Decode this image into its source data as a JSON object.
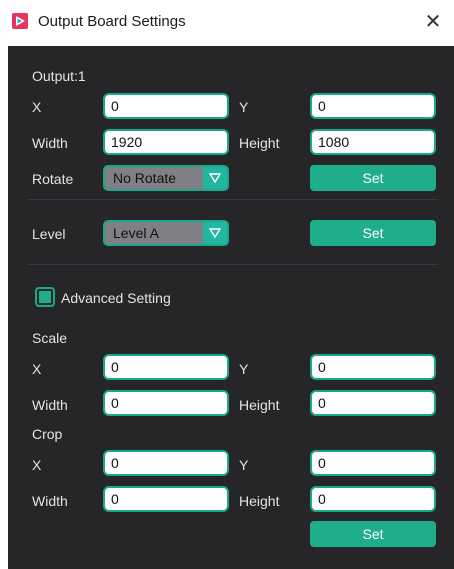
{
  "window": {
    "title": "Output Board Settings",
    "close_label": "✕"
  },
  "output": {
    "heading": "Output:1",
    "x_label": "X",
    "x_value": "0",
    "y_label": "Y",
    "y_value": "0",
    "width_label": "Width",
    "width_value": "1920",
    "height_label": "Height",
    "height_value": "1080",
    "rotate_label": "Rotate",
    "rotate_value": "No Rotate",
    "set_label": "Set"
  },
  "level": {
    "label": "Level",
    "value": "Level A",
    "set_label": "Set"
  },
  "advanced": {
    "label": "Advanced Setting",
    "checked": true
  },
  "scale": {
    "heading": "Scale",
    "x_label": "X",
    "x_value": "0",
    "y_label": "Y",
    "y_value": "0",
    "width_label": "Width",
    "width_value": "0",
    "height_label": "Height",
    "height_value": "0"
  },
  "crop": {
    "heading": "Crop",
    "x_label": "X",
    "x_value": "0",
    "y_label": "Y",
    "y_value": "0",
    "width_label": "Width",
    "width_value": "0",
    "height_label": "Height",
    "height_value": "0",
    "set_label": "Set"
  },
  "colors": {
    "panel_bg": "#262628",
    "accent": "#1fae8b",
    "dropdown_bg": "#7f7f86"
  },
  "icons": {
    "title": "app-logo-icon",
    "dropdown": "triangle-down-icon",
    "close": "close-icon"
  }
}
